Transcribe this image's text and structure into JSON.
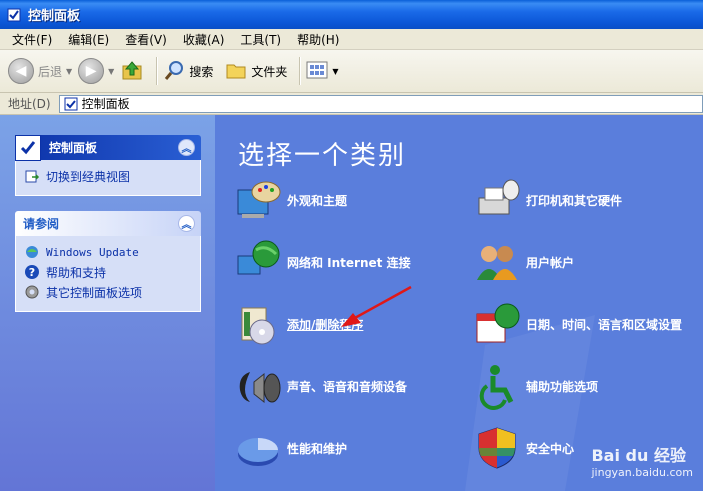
{
  "window": {
    "title": "控制面板"
  },
  "menu": [
    "文件(F)",
    "编辑(E)",
    "查看(V)",
    "收藏(A)",
    "工具(T)",
    "帮助(H)"
  ],
  "toolbar": {
    "back": "后退",
    "search": "搜索",
    "folders": "文件夹"
  },
  "address": {
    "label": "地址(D)",
    "value": "控制面板"
  },
  "sidebar": {
    "panel1": {
      "title": "控制面板",
      "link": "切换到经典视图"
    },
    "panel2": {
      "title": "请参阅",
      "links": [
        "Windows Update",
        "帮助和支持",
        "其它控制面板选项"
      ]
    }
  },
  "main": {
    "heading": "选择一个类别",
    "categories": [
      {
        "label": "外观和主题",
        "icon": "appearance-icon"
      },
      {
        "label": "打印机和其它硬件",
        "icon": "printer-icon"
      },
      {
        "label": "网络和 Internet 连接",
        "icon": "network-icon"
      },
      {
        "label": "用户帐户",
        "icon": "users-icon"
      },
      {
        "label": "添加/删除程序",
        "icon": "add-remove-programs-icon"
      },
      {
        "label": "日期、时间、语言和区域设置",
        "icon": "date-time-icon"
      },
      {
        "label": "声音、语音和音频设备",
        "icon": "sound-icon"
      },
      {
        "label": "辅助功能选项",
        "icon": "accessibility-icon"
      },
      {
        "label": "性能和维护",
        "icon": "performance-icon"
      },
      {
        "label": "安全中心",
        "icon": "security-shield-icon"
      }
    ]
  },
  "watermark": {
    "brand": "Bai du 经验",
    "url": "jingyan.baidu.com"
  },
  "colors": {
    "titlebar": "#0b56d6",
    "main_bg": "#5a7edc",
    "panel_header": "#0c32a8",
    "annotation_arrow": "#e01818"
  }
}
